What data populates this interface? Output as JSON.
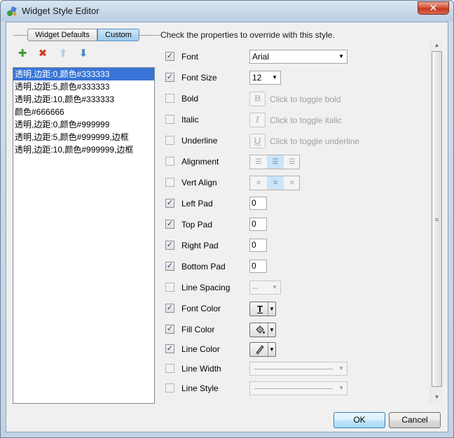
{
  "window": {
    "title": "Widget Style Editor",
    "close_label": "✕"
  },
  "tabs": [
    {
      "label": "Widget Defaults",
      "active": false
    },
    {
      "label": "Custom",
      "active": true
    }
  ],
  "toolbar_icons": [
    "add-icon",
    "delete-icon",
    "move-up-icon",
    "move-down-icon"
  ],
  "style_list": [
    "透明,边距:0,颜色#333333",
    "透明,边距:5,颜色#333333",
    "透明,边距:10,颜色#333333",
    "颜色#666666",
    "透明,边距:0,颜色#999999",
    "透明,边距:5,颜色#999999,边框",
    "透明,边距:10,颜色#999999,边框"
  ],
  "selected_index": 0,
  "instruction": "Check the properties to override with this style.",
  "properties": {
    "font": {
      "label": "Font",
      "checked": true,
      "value": "Arial"
    },
    "font_size": {
      "label": "Font Size",
      "checked": true,
      "value": "12"
    },
    "bold": {
      "label": "Bold",
      "checked": false,
      "button": "B",
      "hint": "Click to toggle bold"
    },
    "italic": {
      "label": "Italic",
      "checked": false,
      "button": "I",
      "hint": "Click to toggle italic"
    },
    "underline": {
      "label": "Underline",
      "checked": false,
      "button": "U",
      "hint": "Click to toggle underline"
    },
    "alignment": {
      "label": "Alignment",
      "checked": false
    },
    "vert_align": {
      "label": "Vert Align",
      "checked": false
    },
    "left_pad": {
      "label": "Left Pad",
      "checked": true,
      "value": "0"
    },
    "top_pad": {
      "label": "Top Pad",
      "checked": true,
      "value": "0"
    },
    "right_pad": {
      "label": "Right Pad",
      "checked": true,
      "value": "0"
    },
    "bottom_pad": {
      "label": "Bottom Pad",
      "checked": true,
      "value": "0"
    },
    "line_spacing": {
      "label": "Line Spacing",
      "checked": false,
      "value": "--"
    },
    "font_color": {
      "label": "Font Color",
      "checked": true
    },
    "fill_color": {
      "label": "Fill Color",
      "checked": true
    },
    "line_color": {
      "label": "Line Color",
      "checked": true
    },
    "line_width": {
      "label": "Line Width",
      "checked": false
    },
    "line_style": {
      "label": "Line Style",
      "checked": false
    }
  },
  "buttons": {
    "ok": "OK",
    "cancel": "Cancel"
  },
  "colors": {
    "selection": "#3875d7",
    "accent": "#3c7fb1"
  }
}
